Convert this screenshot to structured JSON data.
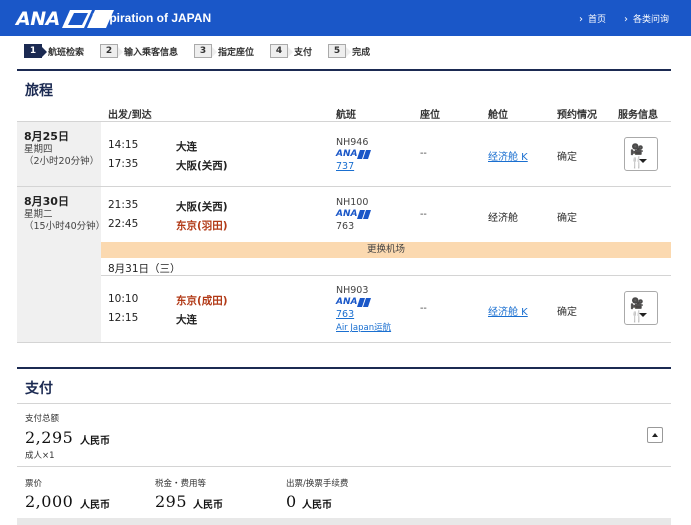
{
  "header": {
    "logo": "ANA",
    "tagline": "Inspiration of JAPAN",
    "links": [
      "首页",
      "各类问询"
    ]
  },
  "steps": [
    {
      "num": "1",
      "label": "航班检索",
      "active": true
    },
    {
      "num": "2",
      "label": "输入乘客信息",
      "active": false
    },
    {
      "num": "3",
      "label": "指定座位",
      "active": false
    },
    {
      "num": "4",
      "label": "支付",
      "active": false
    },
    {
      "num": "5",
      "label": "完成",
      "active": false
    }
  ],
  "itinerary": {
    "title": "旅程",
    "columns": {
      "depart_arrive": "出发/到达",
      "flight": "航班",
      "seat": "座位",
      "cabin": "舱位",
      "status": "预约情况",
      "service": "服务信息"
    },
    "trips": [
      {
        "date": "8月25日",
        "weekday": "星期四",
        "duration": "（2小时20分钟）",
        "segments": [
          {
            "dep_time": "14:15",
            "dep_city": "大连",
            "arr_time": "17:35",
            "arr_city": "大阪(关西)",
            "flight_no": "NH946",
            "airline": "ANA",
            "aircraft": "737",
            "seat": "--",
            "cabin": "经济舱 K",
            "status": "确定"
          }
        ]
      },
      {
        "date": "8月30日",
        "weekday": "星期二",
        "duration": "（15小时40分钟）",
        "segments": [
          {
            "dep_time": "21:35",
            "dep_city": "大阪(关西)",
            "arr_time": "22:45",
            "arr_city": "东京(羽田)",
            "flight_no": "NH100",
            "airline": "ANA",
            "aircraft": "763",
            "seat": "--",
            "cabin": "经济舱",
            "status": "确定"
          },
          {
            "dep_time": "10:10",
            "dep_city": "东京(成田)",
            "arr_time": "12:15",
            "arr_city": "大连",
            "flight_no": "NH903",
            "airline": "ANA",
            "aircraft": "763",
            "operated_by": "Air Japan运航",
            "seat": "--",
            "cabin": "经济舱 K",
            "status": "确定"
          }
        ],
        "change_airport": "更换机场",
        "next_date": "8月31日（三）"
      }
    ]
  },
  "payment": {
    "title": "支付",
    "total_label": "支付总额",
    "total_amount": "2,295",
    "currency": "人民币",
    "passengers": "成人×1",
    "fare_label": "票价",
    "fare_amount": "2,000",
    "tax_label": "税金・费用等",
    "tax_amount": "295",
    "fee_label": "出票/换票手续费",
    "fee_amount": "0"
  },
  "colors": {
    "header_blue": "#1a57c8",
    "navy": "#1b2a52",
    "change_banner": "#fbd9b0",
    "red_city": "#b23a17",
    "link": "#1a6fd0"
  },
  "icons": [
    "ana-logo-icon",
    "meal-entertainment-icon",
    "chevron-down-icon",
    "chevron-up-icon"
  ]
}
